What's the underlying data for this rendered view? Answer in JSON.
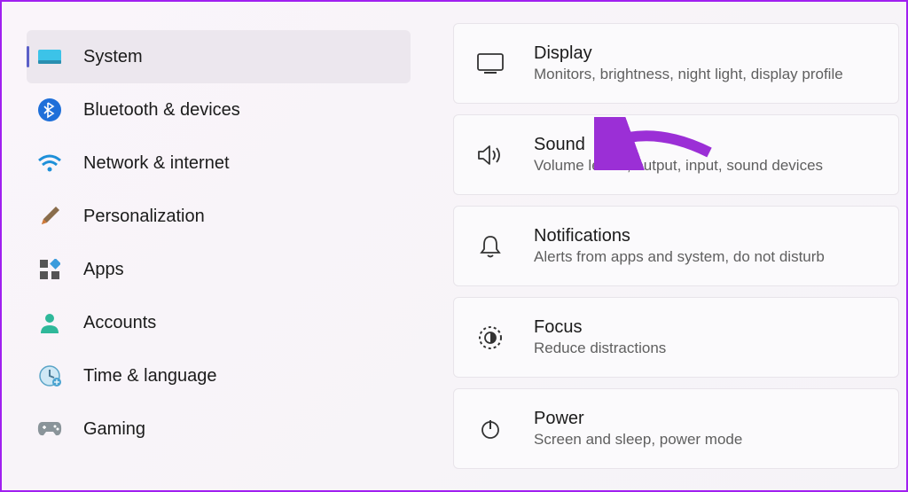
{
  "sidebar": {
    "items": [
      {
        "label": "System",
        "icon": "system",
        "selected": true
      },
      {
        "label": "Bluetooth & devices",
        "icon": "bluetooth",
        "selected": false
      },
      {
        "label": "Network & internet",
        "icon": "wifi",
        "selected": false
      },
      {
        "label": "Personalization",
        "icon": "brush",
        "selected": false
      },
      {
        "label": "Apps",
        "icon": "apps",
        "selected": false
      },
      {
        "label": "Accounts",
        "icon": "account",
        "selected": false
      },
      {
        "label": "Time & language",
        "icon": "clock",
        "selected": false
      },
      {
        "label": "Gaming",
        "icon": "gamepad",
        "selected": false
      }
    ]
  },
  "system_cards": [
    {
      "title": "Display",
      "subtitle": "Monitors, brightness, night light, display profile",
      "icon": "display"
    },
    {
      "title": "Sound",
      "subtitle": "Volume levels, output, input, sound devices",
      "icon": "sound"
    },
    {
      "title": "Notifications",
      "subtitle": "Alerts from apps and system, do not disturb",
      "icon": "bell"
    },
    {
      "title": "Focus",
      "subtitle": "Reduce distractions",
      "icon": "focus"
    },
    {
      "title": "Power",
      "subtitle": "Screen and sleep, power mode",
      "icon": "power"
    }
  ],
  "annotation": {
    "arrow_color": "#9b2fd6"
  }
}
